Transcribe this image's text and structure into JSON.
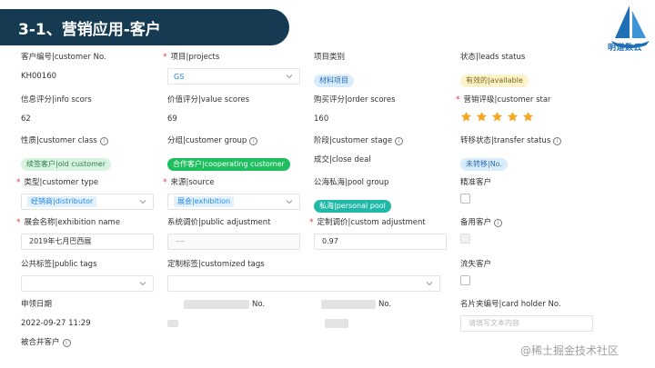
{
  "slide": {
    "title": "3-1、营销应用-客户"
  },
  "logo": {
    "text": "明道数云"
  },
  "fields": {
    "customer_no": {
      "label": "客户编号|customer No.",
      "value": "KH00160"
    },
    "projects": {
      "label": "项目|projects",
      "value": "GS"
    },
    "project_category": {
      "label": "项目类别",
      "tag": "材料项目"
    },
    "leads_status": {
      "label": "状态|leads status",
      "tag": "有效的|available"
    },
    "info_scors": {
      "label": "信息评分|info scors",
      "value": "62"
    },
    "value_scores": {
      "label": "价值评分|value scores",
      "value": "69"
    },
    "order_scores": {
      "label": "购买评分|order scores",
      "value": "160"
    },
    "customer_star": {
      "label": "营销评级|customer star",
      "stars": 5
    },
    "customer_class": {
      "label": "性质|customer class",
      "tag": "续签客户|old customer"
    },
    "customer_group": {
      "label": "分组|customer group",
      "tag": "合作客户|cooperating customer"
    },
    "customer_stage": {
      "label": "阶段|customer stage",
      "value": "成交|close deal"
    },
    "transfer_status": {
      "label": "转移状态|transfer status",
      "tag": "未转移|No."
    },
    "customer_type": {
      "label": "类型|customer type",
      "value": "经销商|distributor"
    },
    "source": {
      "label": "来源|source",
      "value": "展会|exhibition"
    },
    "pool_group": {
      "label": "公海私海|pool group",
      "tag": "私海|personal pool"
    },
    "precise_customer": {
      "label": "精准客户"
    },
    "exhibition_name": {
      "label": "展会名称|exhibition name",
      "value": "2019年七月巴西展"
    },
    "public_adjustment": {
      "label": "系统调价|public adjustment"
    },
    "custom_adjustment": {
      "label": "定制调价|custom adjustment",
      "value": "0.97"
    },
    "backup_customer": {
      "label": "备用客户"
    },
    "public_tags": {
      "label": "公共标签|public tags"
    },
    "customized_tags": {
      "label": "定制标签|customized tags"
    },
    "lost_customer": {
      "label": "流失客户"
    },
    "apply_date": {
      "label": "申领日期",
      "value": "2022-09-27 11:29"
    },
    "masked_1": {
      "label": "No."
    },
    "masked_2": {
      "label": "No."
    },
    "card_holder_no": {
      "label": "名片夹编号|card holder No.",
      "placeholder": "请填写文本内容"
    },
    "merged_customer": {
      "label": "被合并客户"
    }
  },
  "watermark": "@稀土掘金技术社区",
  "colors": {
    "title_bar": "#153a52",
    "accent_blue": "#1e88e5",
    "star": "#f5a623",
    "tag_green": "#1fbf5f",
    "tag_teal": "#20b8a6",
    "required": "#e6383a"
  }
}
